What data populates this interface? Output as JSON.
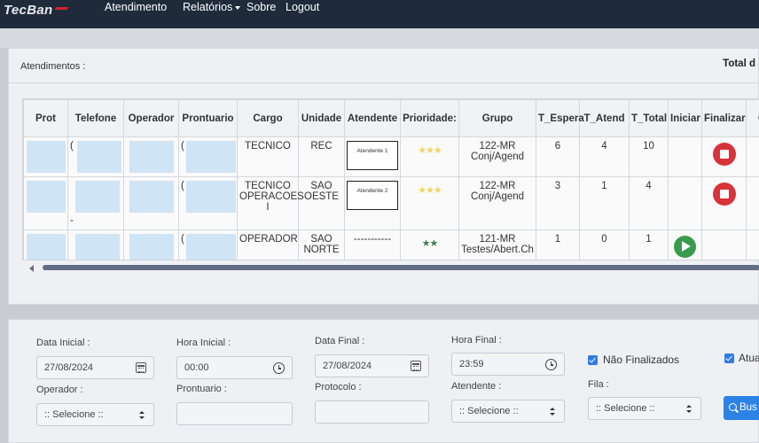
{
  "nav": {
    "brand": "TecBan",
    "items": [
      {
        "label": "Atendimento"
      },
      {
        "label": "Relatórios"
      },
      {
        "label": "Sobre"
      },
      {
        "label": "Logout"
      }
    ]
  },
  "panel": {
    "title": "Atendimentos :",
    "total_label": "Total d"
  },
  "table": {
    "columns": [
      "Prot",
      "Telefone",
      "Operador",
      "Prontuario",
      "Cargo",
      "Unidade",
      "Atendente",
      "Prioridade:",
      "Grupo",
      "T_Espera",
      "T_Atend",
      "T_Total",
      "Iniciar",
      "Finalizar",
      "C"
    ],
    "rows": [
      {
        "telefone": "(",
        "prontuario": "(",
        "cargo": "TECNICO",
        "unidade": "REC",
        "atendente": "Atendente 1",
        "prioridade_stars": "★★★",
        "prioridade_color": "yellow",
        "grupo": "122-MR Conj/Agend",
        "t_espera": "6",
        "t_atend": "4",
        "t_total": "10",
        "action": "finalizar"
      },
      {
        "telefone": "-",
        "prontuario": "(",
        "cargo": "TECNICO OPERACOES I",
        "unidade": "SAO OESTE",
        "atendente": "Atendente 2",
        "prioridade_stars": "★★★",
        "prioridade_color": "yellow",
        "grupo": "122-MR Conj/Agend",
        "t_espera": "3",
        "t_atend": "1",
        "t_total": "4",
        "action": "finalizar"
      },
      {
        "telefone": "-",
        "prontuario": "(",
        "cargo": "OPERADOR",
        "unidade": "SAO NORTE",
        "atendente": "-----------",
        "prioridade_stars": "★★",
        "prioridade_color": "green",
        "grupo": "121-MR Testes/Abert.Ch",
        "t_espera": "1",
        "t_atend": "0",
        "t_total": "1",
        "action": "iniciar"
      }
    ]
  },
  "filters": {
    "data_inicial": {
      "label": "Data Inicial :",
      "value": "27/08/2024"
    },
    "hora_inicial": {
      "label": "Hora Inicial :",
      "value": "00:00"
    },
    "data_final": {
      "label": "Data Final :",
      "value": "27/08/2024"
    },
    "hora_final": {
      "label": "Hora Final :",
      "value": "23:59"
    },
    "nao_finalizados": {
      "label": "Não Finalizados",
      "checked": true
    },
    "atualizar": {
      "label": "Atua",
      "checked": true
    },
    "operador": {
      "label": "Operador :",
      "value": ":: Selecione ::"
    },
    "prontuario": {
      "label": "Prontuario :",
      "value": ""
    },
    "protocolo": {
      "label": "Protocolo :",
      "value": ""
    },
    "atendente": {
      "label": "Atendente :",
      "value": ":: Selecione ::"
    },
    "fila": {
      "label": "Fila :",
      "value": ":: Selecione ::"
    },
    "search_label": "Bus"
  },
  "colors": {
    "navbar": "#1f2b3b",
    "stop": "#d7333b",
    "play": "#3a9a4d",
    "primary": "#2e82e6",
    "star_yellow": "#f4d35e",
    "star_green": "#3d7e4c"
  }
}
